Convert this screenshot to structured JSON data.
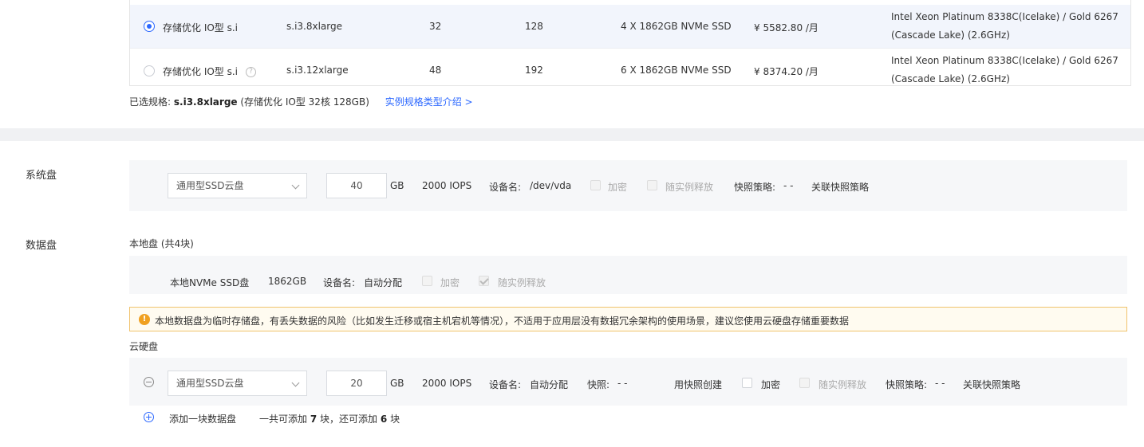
{
  "instances": [
    {
      "name": "存储优化 IO型 s.i",
      "spec": "s.i3.8xlarge",
      "vcpu": "32",
      "mem": "128",
      "disk": "4 X 1862GB NVMe SSD",
      "price": "¥ 5582.80 /月",
      "cpu_model": "Intel Xeon Platinum 8338C(Icelake) / Gold 6267 (Cascade Lake) (2.6GHz)",
      "selected": true
    },
    {
      "name": "存储优化 IO型 s.i",
      "spec": "s.i3.12xlarge",
      "vcpu": "48",
      "mem": "192",
      "disk": "6 X 1862GB NVMe SSD",
      "price": "¥ 8374.20 /月",
      "cpu_model": "Intel Xeon Platinum 8338C(Icelake) / Gold 6267 (Cascade Lake) (2.6GHz)",
      "selected": false
    }
  ],
  "selection": {
    "prefix": "已选规格:",
    "spec": "s.i3.8xlarge",
    "detail": "(存储优化 IO型 32核 128GB)",
    "intro_link": "实例规格类型介绍 >"
  },
  "system_disk": {
    "label": "系统盘",
    "type": "通用型SSD云盘",
    "size": "40",
    "unit": "GB",
    "iops": "2000 IOPS",
    "device_label": "设备名:",
    "device": "/dev/vda",
    "encrypt": "加密",
    "release": "随实例释放",
    "snapshot_policy_label": "快照策略:",
    "snapshot_policy_value": "- -",
    "snapshot_link": "关联快照策略"
  },
  "data_disk": {
    "label": "数据盘",
    "local_title": "本地盘 (共4块)",
    "local_type": "本地NVMe SSD盘",
    "local_size": "1862GB",
    "local_device_label": "设备名:",
    "local_device": "自动分配",
    "local_encrypt": "加密",
    "local_release": "随实例释放",
    "warning": "本地数据盘为临时存储盘，有丢失数据的风险（比如发生迁移或宿主机宕机等情况），不适用于应用层没有数据冗余架构的使用场景，建议您使用云硬盘存储重要数据",
    "cloud_title": "云硬盘",
    "cloud_type": "通用型SSD云盘",
    "cloud_size": "20",
    "unit": "GB",
    "iops": "2000 IOPS",
    "device_label": "设备名:",
    "device": "自动分配",
    "snapshot_label": "快照:",
    "snapshot_value": "- -",
    "create_from_snapshot": "用快照创建",
    "encrypt": "加密",
    "release": "随实例释放",
    "snapshot_policy_label": "快照策略:",
    "snapshot_policy_value": "- -",
    "snapshot_link": "关联快照策略",
    "add_link": "添加一块数据盘",
    "quota_prefix": "一共可添加",
    "quota_total": "7",
    "quota_mid": "块，还可添加",
    "quota_left": "6",
    "quota_suffix": "块"
  }
}
